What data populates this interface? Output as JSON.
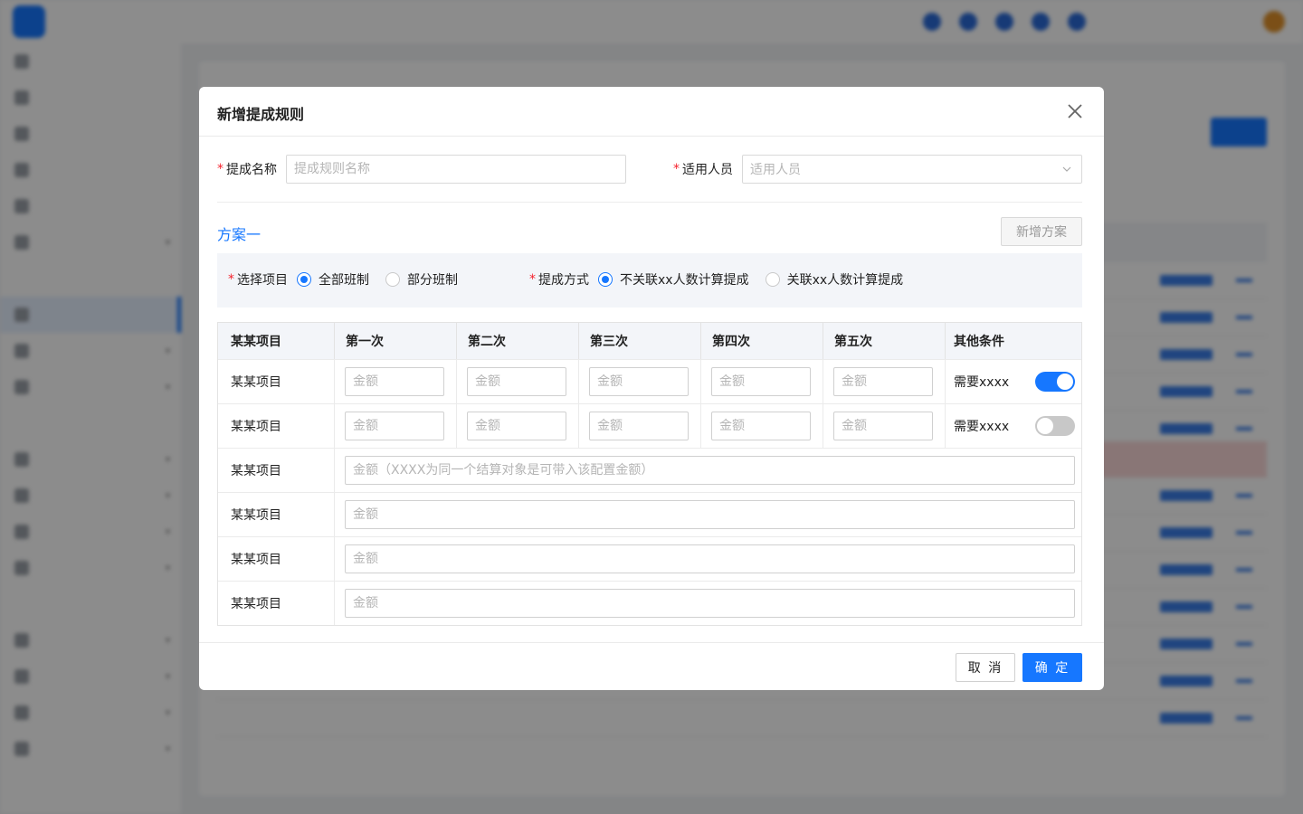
{
  "modal": {
    "title": "新增提成规则",
    "name_label": "提成名称",
    "name_placeholder": "提成规则名称",
    "staff_label": "适用人员",
    "staff_placeholder": "适用人员",
    "plan_title": "方案一",
    "add_plan_label": "新增方案",
    "project_label": "选择项目",
    "project_options": [
      "全部班制",
      "部分班制"
    ],
    "project_selected": "全部班制",
    "method_label": "提成方式",
    "method_options": [
      "不关联xx人数计算提成",
      "关联xx人数计算提成"
    ],
    "method_selected": "不关联xx人数计算提成",
    "cancel_label": "取 消",
    "ok_label": "确 定"
  },
  "table": {
    "headers": [
      "某某项目",
      "第一次",
      "第二次",
      "第三次",
      "第四次",
      "第五次",
      "其他条件"
    ],
    "amount_placeholder": "金额",
    "rows_tiered": [
      {
        "label": "某某项目",
        "condition": "需要xxxx",
        "switch_on": true
      },
      {
        "label": "某某项目",
        "condition": "需要xxxx",
        "switch_on": false
      }
    ],
    "rows_wide": [
      {
        "label": "某某项目",
        "placeholder": "金额（XXXX为同一个结算对象是可带入该配置金额）"
      },
      {
        "label": "某某项目",
        "placeholder": "金额"
      },
      {
        "label": "某某项目",
        "placeholder": "金额"
      },
      {
        "label": "某某项目",
        "placeholder": "金额"
      }
    ]
  },
  "colors": {
    "primary": "#1677ff",
    "required": "#f5222d",
    "overlay": "rgba(0,0,0,0.45)"
  }
}
